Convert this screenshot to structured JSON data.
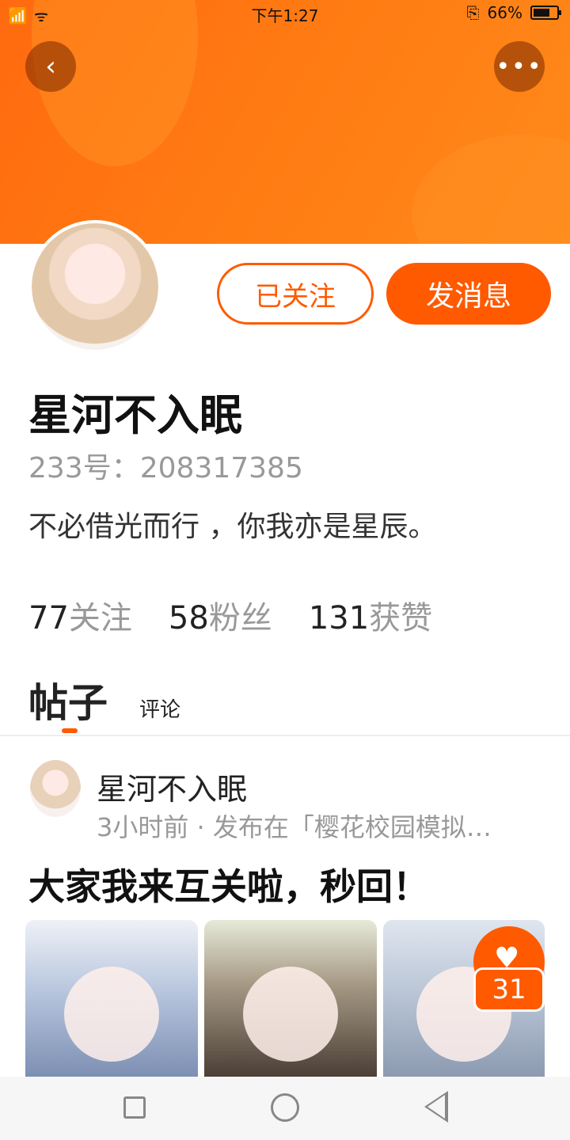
{
  "status_bar": {
    "time": "下午1:27",
    "battery_percent": "66%",
    "battery_level": 0.66
  },
  "profile": {
    "name": "星河不入眠",
    "id_line": "233号：208317385",
    "bio": "不必借光而行 ，你我亦是星辰。",
    "follow_button": "已关注",
    "message_button": "发消息",
    "stats": [
      {
        "num": "77",
        "label": "关注"
      },
      {
        "num": "58",
        "label": "粉丝"
      },
      {
        "num": "131",
        "label": "获赞"
      }
    ]
  },
  "tabs": {
    "active": "帖子",
    "other": "评论"
  },
  "post": {
    "author": "星河不入眠",
    "meta": "3小时前 · 发布在「樱花校园模拟…",
    "title": "大家我来互关啦，秒回！",
    "like_count": "31"
  },
  "colors": {
    "accent": "#ff5a00",
    "banner": "#ff7a12"
  }
}
